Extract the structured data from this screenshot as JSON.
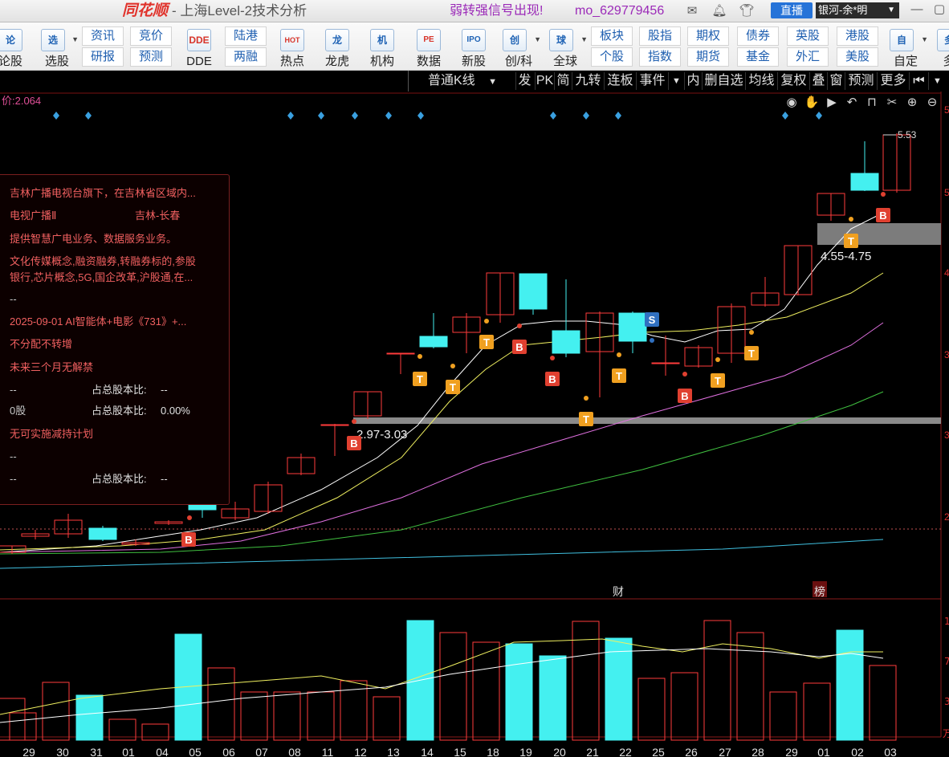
{
  "titlebar": {
    "logo": "同花顺",
    "title": "- 上海Level-2技术分析",
    "signal": "弱转强信号出现!",
    "user": "mo_629779456",
    "icons": [
      "mail-icon",
      "bell-icon",
      "shirt-icon"
    ],
    "live_label": "直播",
    "account": "银河-余*明"
  },
  "toolbar": {
    "buttons": [
      {
        "label": "论股",
        "icon": "论"
      },
      {
        "label": "选股",
        "icon": "选"
      },
      {
        "label": "DDE",
        "icon": "DDE"
      },
      {
        "label": "热点",
        "icon": "HOT"
      },
      {
        "label": "龙虎",
        "icon": "龙"
      },
      {
        "label": "机构",
        "icon": "机"
      },
      {
        "label": "数据",
        "icon": "PE"
      },
      {
        "label": "新股",
        "icon": "IPO"
      },
      {
        "label": "创/科",
        "icon": "创"
      },
      {
        "label": "全球",
        "icon": "球"
      },
      {
        "label": "自定",
        "icon": "自"
      },
      {
        "label": "多",
        "icon": "多"
      }
    ],
    "pairs": [
      [
        "资讯",
        "研报"
      ],
      [
        "竞价",
        "预测"
      ],
      [
        "陆港",
        "两融"
      ],
      [
        "板块",
        "个股"
      ],
      [
        "股指",
        "指数"
      ],
      [
        "期权",
        "期货"
      ],
      [
        "债券",
        "基金"
      ],
      [
        "英股",
        "外汇"
      ],
      [
        "港股",
        "美股"
      ]
    ]
  },
  "ktoolbar": {
    "period": "普通K线",
    "items": [
      "发",
      "PK",
      "简",
      "九转",
      "连板",
      "事件",
      "内",
      "删自选",
      "均线",
      "复权",
      "叠",
      "窗",
      "预测",
      "更多"
    ]
  },
  "chart": {
    "avg_price_label": "价:2.064",
    "dates": [
      "29",
      "30",
      "31",
      "01",
      "04",
      "05",
      "06",
      "07",
      "08",
      "11",
      "12",
      "13",
      "14",
      "15",
      "18",
      "19",
      "20",
      "21",
      "22",
      "25",
      "26",
      "27",
      "28",
      "29",
      "01",
      "02",
      "03"
    ],
    "high_label": "5.53",
    "zones": [
      {
        "label": "2.97-3.03",
        "low": 2.97,
        "high": 3.03
      },
      {
        "label": "4.55-4.75",
        "low": 4.55,
        "high": 4.75
      }
    ],
    "event_marks": [
      "财",
      "榜"
    ],
    "price_axis": [
      "5",
      "5",
      "4",
      "3",
      "3",
      "2",
      "2"
    ],
    "vol_axis": [
      "1",
      "7",
      "3",
      "万"
    ],
    "colors": {
      "up": "#ff3b3b",
      "down": "#44f0f0",
      "ma5": "#ffffff",
      "ma10": "#f0f060",
      "ma20": "#e070e0",
      "ma60": "#40c040",
      "ma120": "#40c0e0"
    }
  },
  "info": {
    "desc": "吉林广播电视台旗下，在吉林省区域内...",
    "industry": "电视广播Ⅱ",
    "region": "吉林-长春",
    "business": "提供智慧广电业务、数据服务业务。",
    "concepts1": "文化传媒概念,融资融券,转融券标的,参股",
    "concepts2": "银行,芯片概念,5G,国企改革,沪股通,在...",
    "dash1": "--",
    "event": "2025-09-01 AI智能体+电影《731》+...",
    "dividend": "不分配不转增",
    "unlock": "未来三个月无解禁",
    "h1_left": "--",
    "h1_label": "占总股本比:",
    "h1_val": "--",
    "h2_left": "0股",
    "h2_label": "占总股本比:",
    "h2_val": "0.00%",
    "reduce": "无可实施减持计划",
    "dash2": "--",
    "h3_left": "--",
    "h3_label": "占总股本比:",
    "h3_val": "--"
  }
}
